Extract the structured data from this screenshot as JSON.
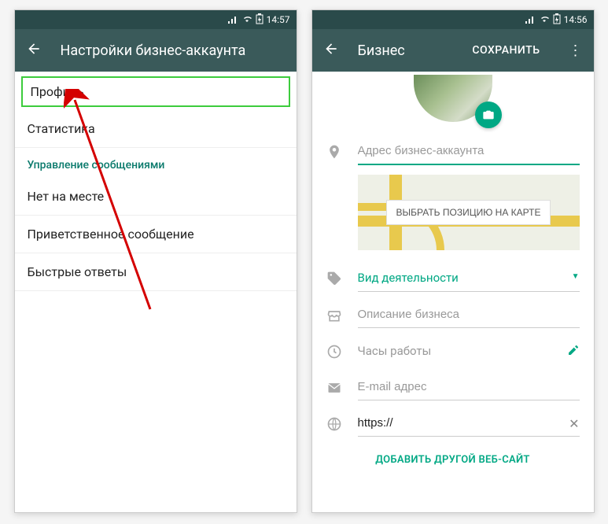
{
  "left": {
    "status": {
      "time": "14:57"
    },
    "appbar": {
      "title": "Настройки бизнес-аккаунта"
    },
    "menu": {
      "profile": "Профиль",
      "stats": "Статистика",
      "section": "Управление сообщениями",
      "away": "Нет на месте",
      "greeting": "Приветственное сообщение",
      "quick": "Быстрые ответы"
    }
  },
  "right": {
    "status": {
      "time": "14:56"
    },
    "appbar": {
      "title": "Бизнес",
      "action": "СОХРАНИТЬ"
    },
    "fields": {
      "address_ph": "Адрес бизнес-аккаунта",
      "map_btn": "ВЫБРАТЬ ПОЗИЦИЮ НА КАРТЕ",
      "category": "Вид деятельности",
      "description_ph": "Описание бизнеса",
      "hours": "Часы работы",
      "email_ph": "E-mail адрес",
      "website": "https://",
      "add_site": "ДОБАВИТЬ ДРУГОЙ ВЕБ-САЙТ"
    }
  }
}
